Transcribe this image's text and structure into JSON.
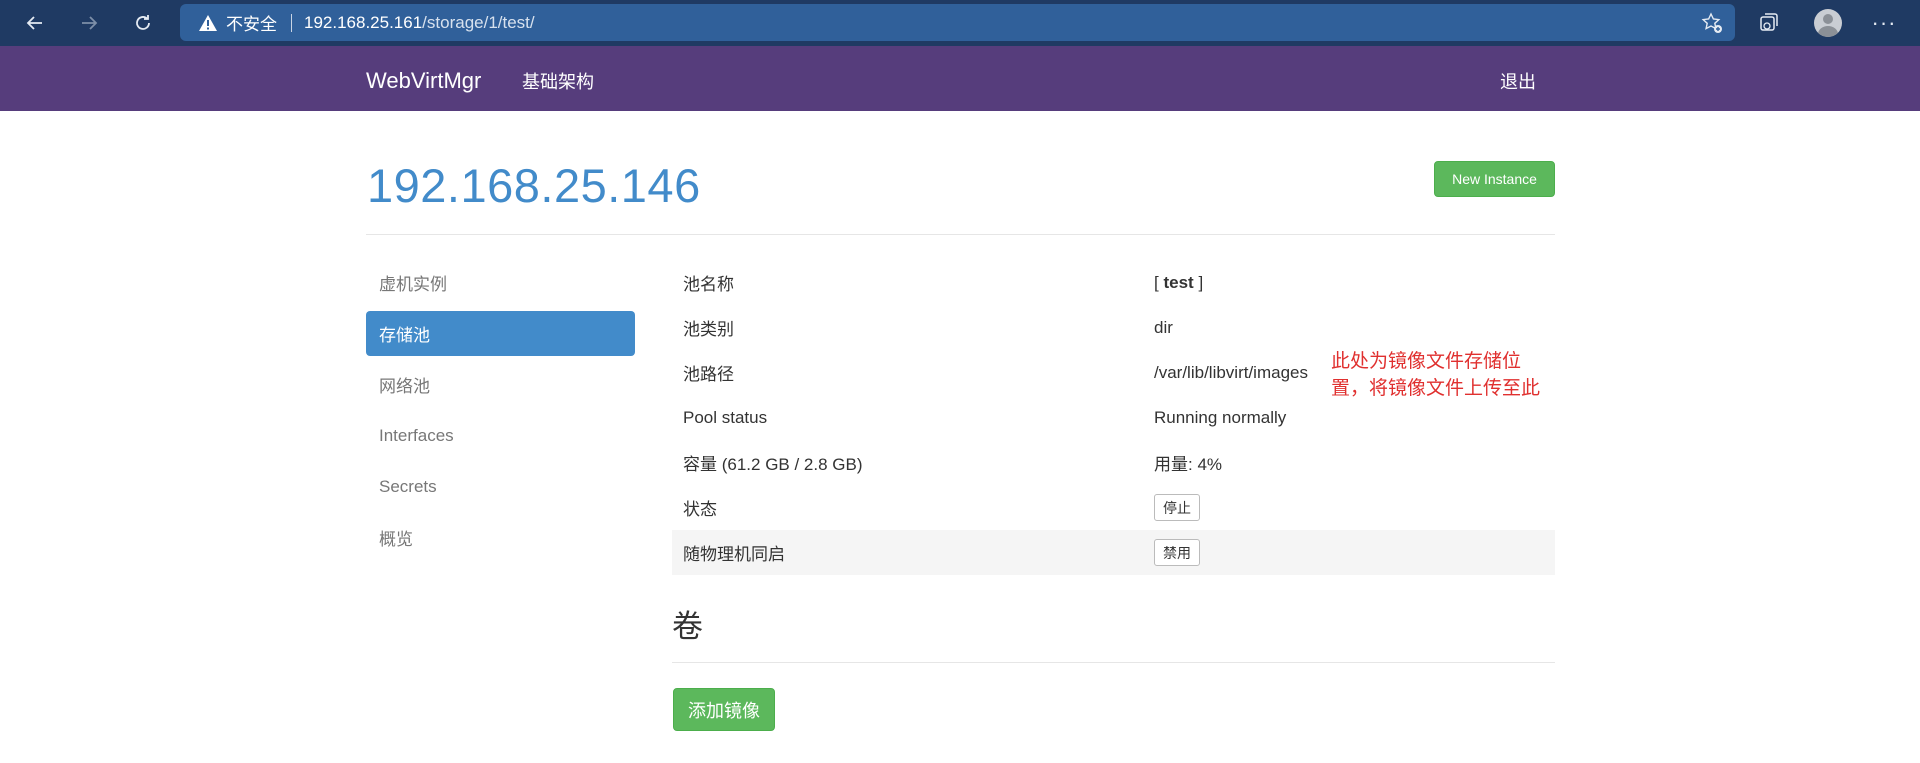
{
  "browser": {
    "security_label": "不安全",
    "url_host": "192.168.25.161",
    "url_path": "/storage/1/test/",
    "icons": [
      "back-icon",
      "forward-icon",
      "refresh-icon",
      "warning-icon",
      "favorite-icon",
      "collections-icon",
      "profile-icon",
      "more-icon"
    ]
  },
  "navbar": {
    "brand": "WebVirtMgr",
    "infrastructure_link": "基础架构",
    "logout_link": "退出"
  },
  "page": {
    "title": "192.168.25.146",
    "new_instance_button": "New Instance"
  },
  "sidebar": {
    "items": [
      {
        "label": "虚机实例",
        "active": false
      },
      {
        "label": "存储池",
        "active": true
      },
      {
        "label": "网络池",
        "active": false
      },
      {
        "label": "Interfaces",
        "active": false
      },
      {
        "label": "Secrets",
        "active": false
      },
      {
        "label": "概览",
        "active": false
      }
    ]
  },
  "pool": {
    "name_label": "池名称",
    "name_open": "[",
    "name_value": "test",
    "name_close": "]",
    "type_label": "池类别",
    "type_value": "dir",
    "path_label": "池路径",
    "path_value": "/var/lib/libvirt/images",
    "path_note": "此处为镜像文件存储位置，将镜像文件上传至此",
    "status_label": "Pool status",
    "status_value": "Running normally",
    "capacity_label": "容量 (61.2 GB / 2.8 GB)",
    "usage_value": "用量: 4%",
    "state_label": "状态",
    "state_button": "停止",
    "autostart_label": "随物理机同启",
    "autostart_button": "禁用"
  },
  "volumes": {
    "title": "卷",
    "add_button": "添加镜像"
  },
  "colors": {
    "navbar": "#563d7c",
    "primary": "#428bca",
    "success": "#5cb85c",
    "note": "#e0302f",
    "chrome": "#1f3a63"
  }
}
